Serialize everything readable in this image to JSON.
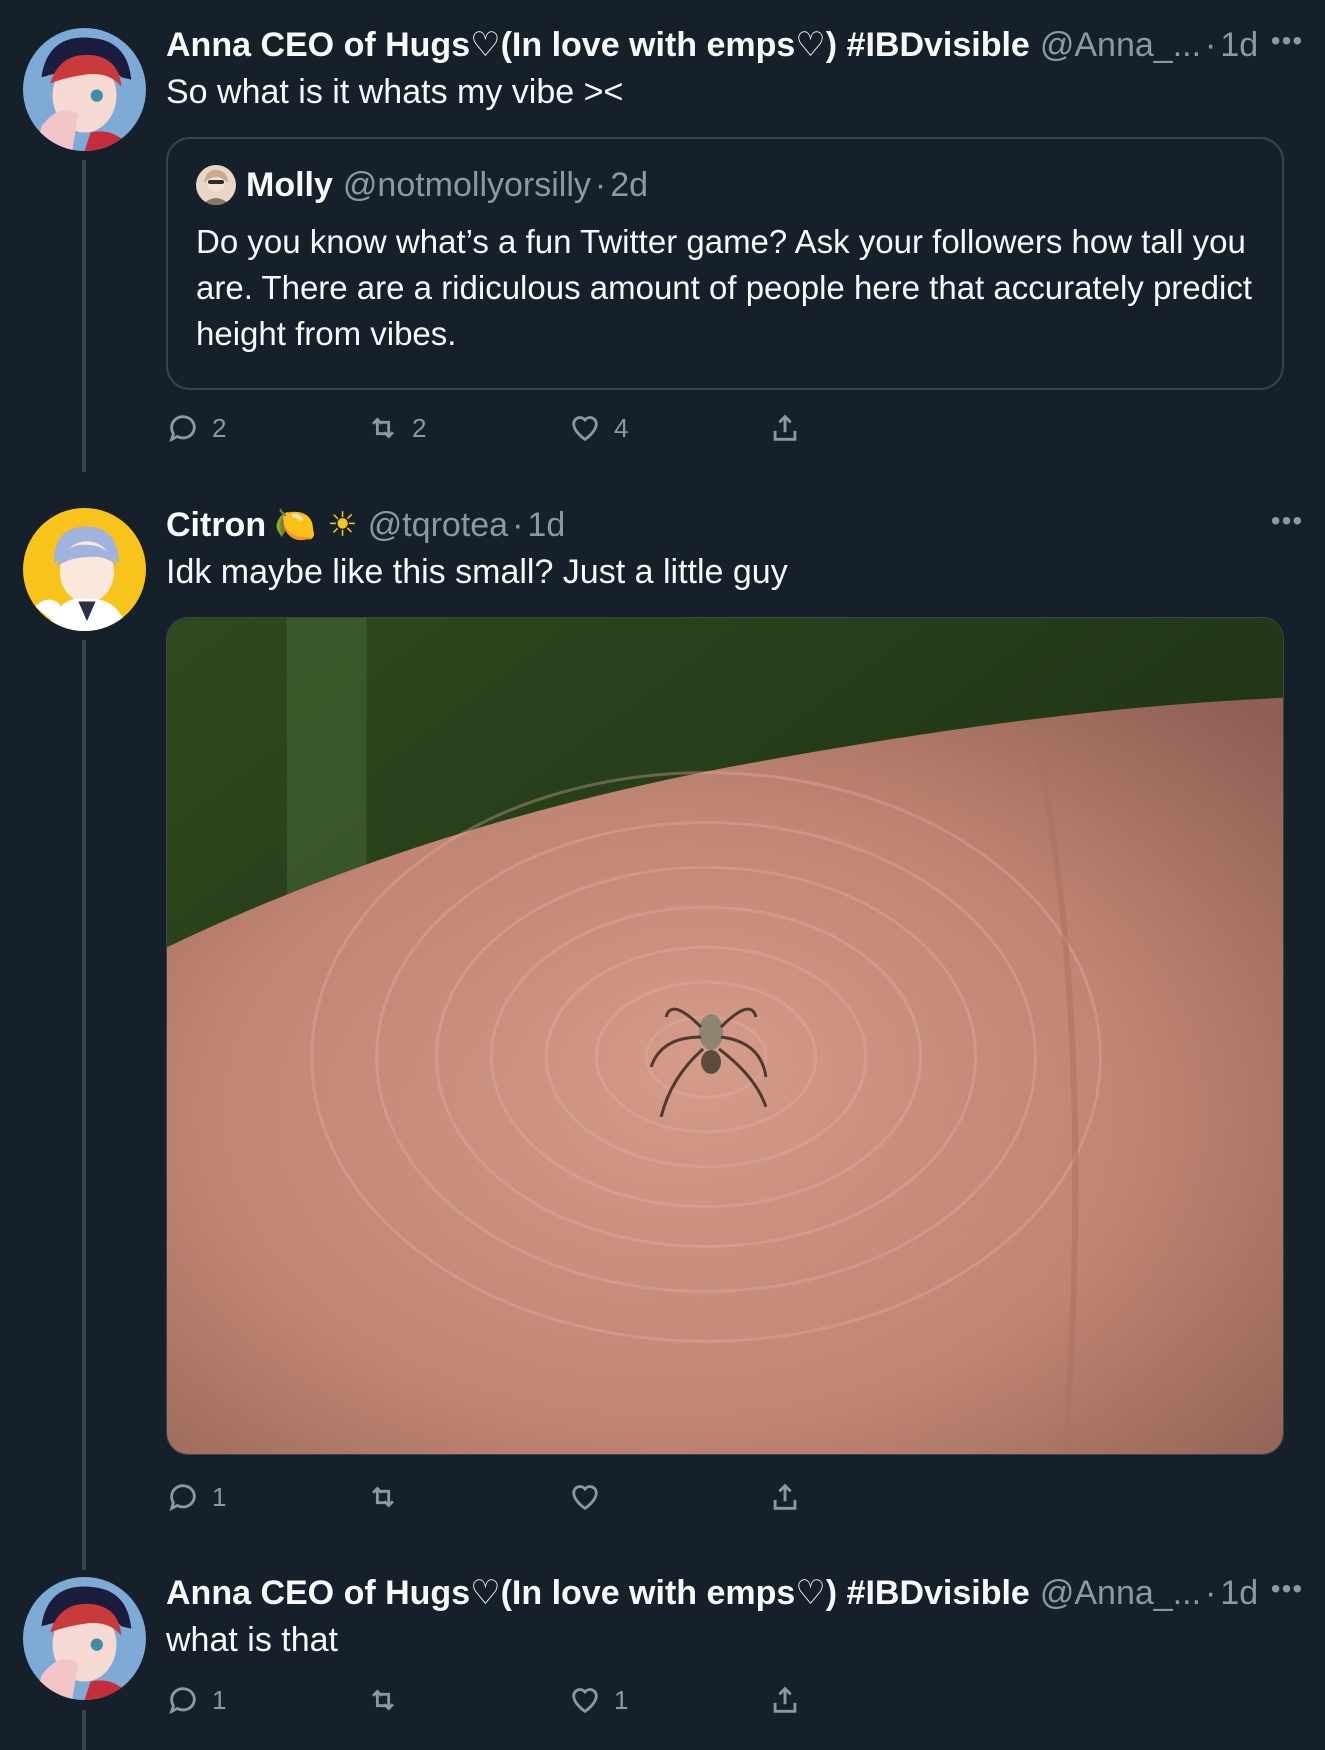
{
  "tweets": [
    {
      "display_name": "Anna CEO of Hugs♡(In love with emps♡) #IBDvisible",
      "handle": "@Anna_...",
      "time": "1d",
      "text": "So what is it whats my vibe ><",
      "quote": {
        "display_name": "Molly",
        "handle": "@notmollyorsilly",
        "time": "2d",
        "text": "Do you know what’s a fun Twitter game? Ask your followers how tall you are. There are a ridiculous amount of people here that accurately predict height from vibes."
      },
      "reply_count": "2",
      "retweet_count": "2",
      "like_count": "4"
    },
    {
      "display_name": "Citron",
      "emojis": "🍋 ☀",
      "handle": "@tqrotea",
      "time": "1d",
      "text": "Idk maybe like this small? Just a little guy",
      "reply_count": "1",
      "retweet_count": "",
      "like_count": ""
    },
    {
      "display_name": "Anna CEO of Hugs♡(In love with emps♡) #IBDvisible",
      "handle": "@Anna_...",
      "time": "1d",
      "text": "what is that",
      "reply_count": "1",
      "retweet_count": "",
      "like_count": "1"
    }
  ],
  "dot_separator": "·",
  "more_glyph": "•••",
  "icons": {
    "reply": "reply-icon",
    "retweet": "retweet-icon",
    "like": "like-icon",
    "share": "share-icon",
    "more": "more-icon"
  },
  "colors": {
    "background": "#15202b",
    "secondary_text": "#8b98a5",
    "border": "#38444d"
  }
}
